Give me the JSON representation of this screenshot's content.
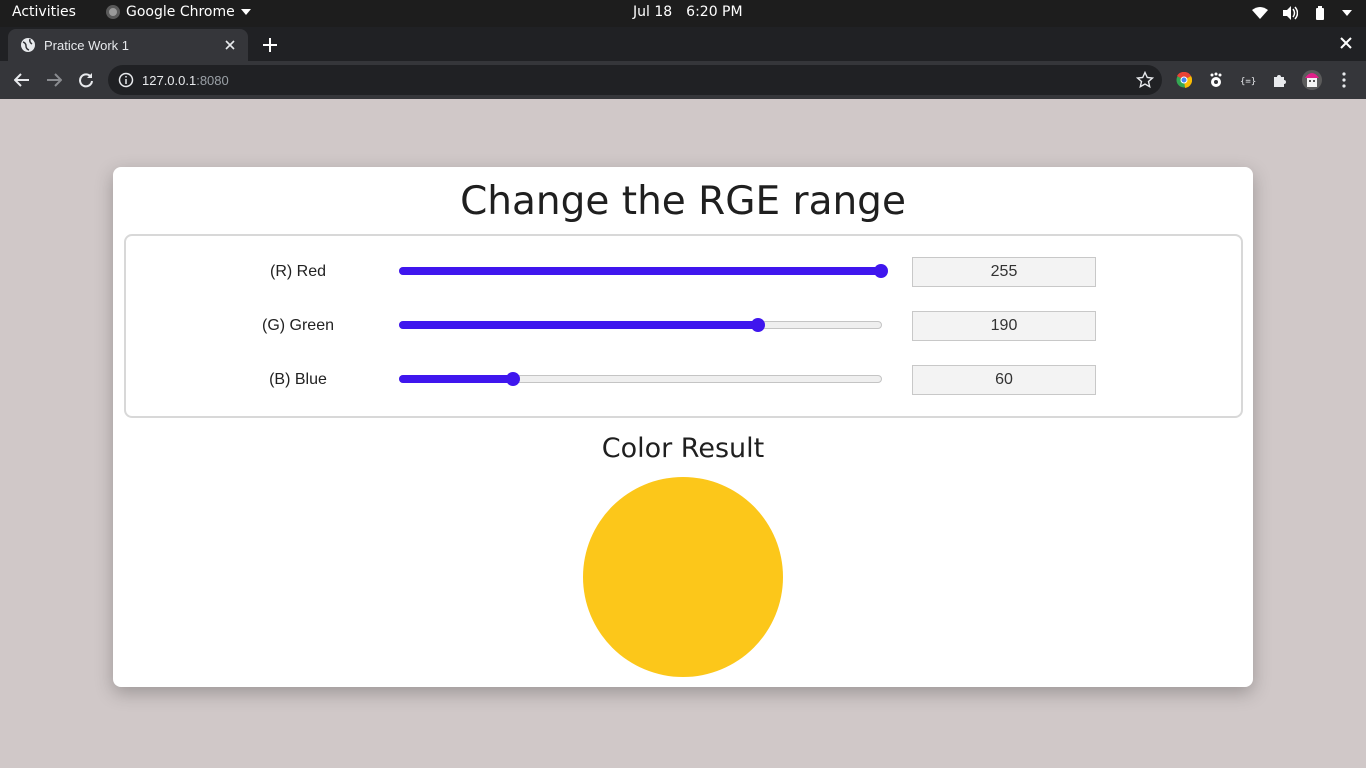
{
  "system_bar": {
    "activities": "Activities",
    "app_name": "Google Chrome",
    "date": "Jul 18",
    "time": "6:20 PM"
  },
  "browser": {
    "tab_title": "Pratice Work 1",
    "url_host": "127.0.0.1",
    "url_port": ":8080"
  },
  "page": {
    "title": "Change the RGE range",
    "sliders": [
      {
        "label": "(R) Red",
        "value": "255",
        "max": 255
      },
      {
        "label": "(G) Green",
        "value": "190",
        "max": 255
      },
      {
        "label": "(B) Blue",
        "value": "60",
        "max": 255
      }
    ],
    "result_title": "Color Result",
    "result_color": "#fcc71a",
    "slider_color": "#3f16ee"
  }
}
